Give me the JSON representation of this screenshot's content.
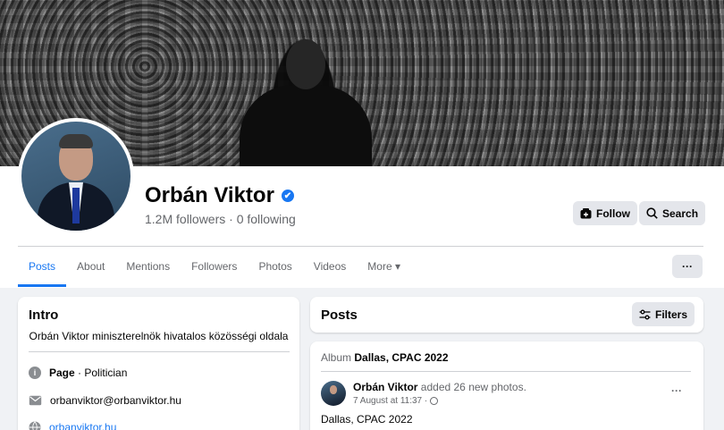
{
  "profile": {
    "name": "Orbán Viktor",
    "verified_mark": "✔",
    "followers": "1.2M followers · 0 following"
  },
  "actions": {
    "follow_label": "Follow",
    "search_label": "Search",
    "more_dots": "···"
  },
  "tabs": [
    {
      "label": "Posts",
      "active": true
    },
    {
      "label": "About"
    },
    {
      "label": "Mentions"
    },
    {
      "label": "Followers"
    },
    {
      "label": "Photos"
    },
    {
      "label": "Videos"
    },
    {
      "label": "More ▾"
    }
  ],
  "intro": {
    "title": "Intro",
    "bio": "Orbán Viktor miniszterelnök hivatalos közösségi oldala",
    "page_type_label": "Page",
    "page_type_value": " · Politician",
    "email": "orbanviktor@orbanviktor.hu",
    "website": "orbanviktor.hu"
  },
  "posts": {
    "title": "Posts",
    "filters_label": "Filters",
    "album_prefix": "Album ",
    "album_name": "Dallas, CPAC 2022",
    "post_author": "Orbán Viktor",
    "post_action": " added 26 new photos.",
    "post_time": "7 August at 11:37 ·",
    "post_dots": "···",
    "post_text": "Dallas, CPAC 2022"
  },
  "colors": {
    "accent": "#1877f2",
    "background": "#f0f2f5",
    "secondary_text": "#65676b"
  }
}
